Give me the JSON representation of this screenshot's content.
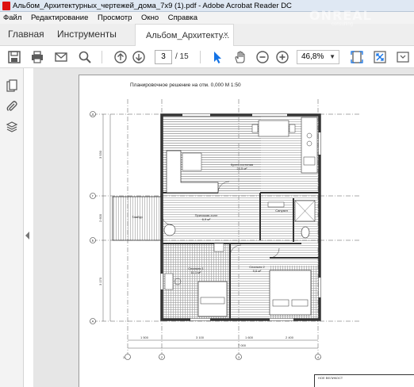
{
  "window": {
    "title": "Альбом_Архитектурных_чертежей_дома_7х9 (1).pdf - Adobe Acrobat Reader DC"
  },
  "menu": {
    "items": [
      "Файл",
      "Редактирование",
      "Просмотр",
      "Окно",
      "Справка"
    ]
  },
  "tabs": {
    "home": "Главная",
    "tools": "Инструменты",
    "document": "Альбом_Архитекту...",
    "document_close": "×"
  },
  "toolbar": {
    "page_current": "3",
    "page_total": "/ 15",
    "zoom": "46,8%",
    "zoom_caret": "▼"
  },
  "watermark": {
    "brand": "ONREAL",
    "sub": "consulting"
  },
  "plan": {
    "title": "Планировочное решение на отм. 0,000 М 1:50",
    "rooms": [
      {
        "name": "Кухня-гостиная",
        "area": "20,5 м²"
      },
      {
        "name": "Тамбур",
        "area": ""
      },
      {
        "name": "Прихожая-холл",
        "area": "6,9 м²"
      },
      {
        "name": "Санузел",
        "area": ""
      },
      {
        "name": "Спальня 1",
        "area": "11,1 м²"
      },
      {
        "name": "Спальня 2",
        "area": "9,6 м²"
      }
    ],
    "axes_letters": [
      "A",
      "Б",
      "В",
      "Г",
      "Д"
    ],
    "axes_numbers": [
      "1",
      "2",
      "3",
      "4"
    ],
    "dims_bottom": [
      "1 500",
      "3 100",
      "1 600",
      "2 400"
    ],
    "dims_total": "7 000",
    "dims_left": [
      "3 530",
      "2 600",
      "3 170"
    ],
    "stamp": "НОЕ ВЕЛИКОСТ"
  },
  "colors": {
    "wall": "#333333",
    "hatch": "#9a9a9a",
    "viewer_bg": "#e6e6e6",
    "accent_blue": "#1473e6"
  }
}
